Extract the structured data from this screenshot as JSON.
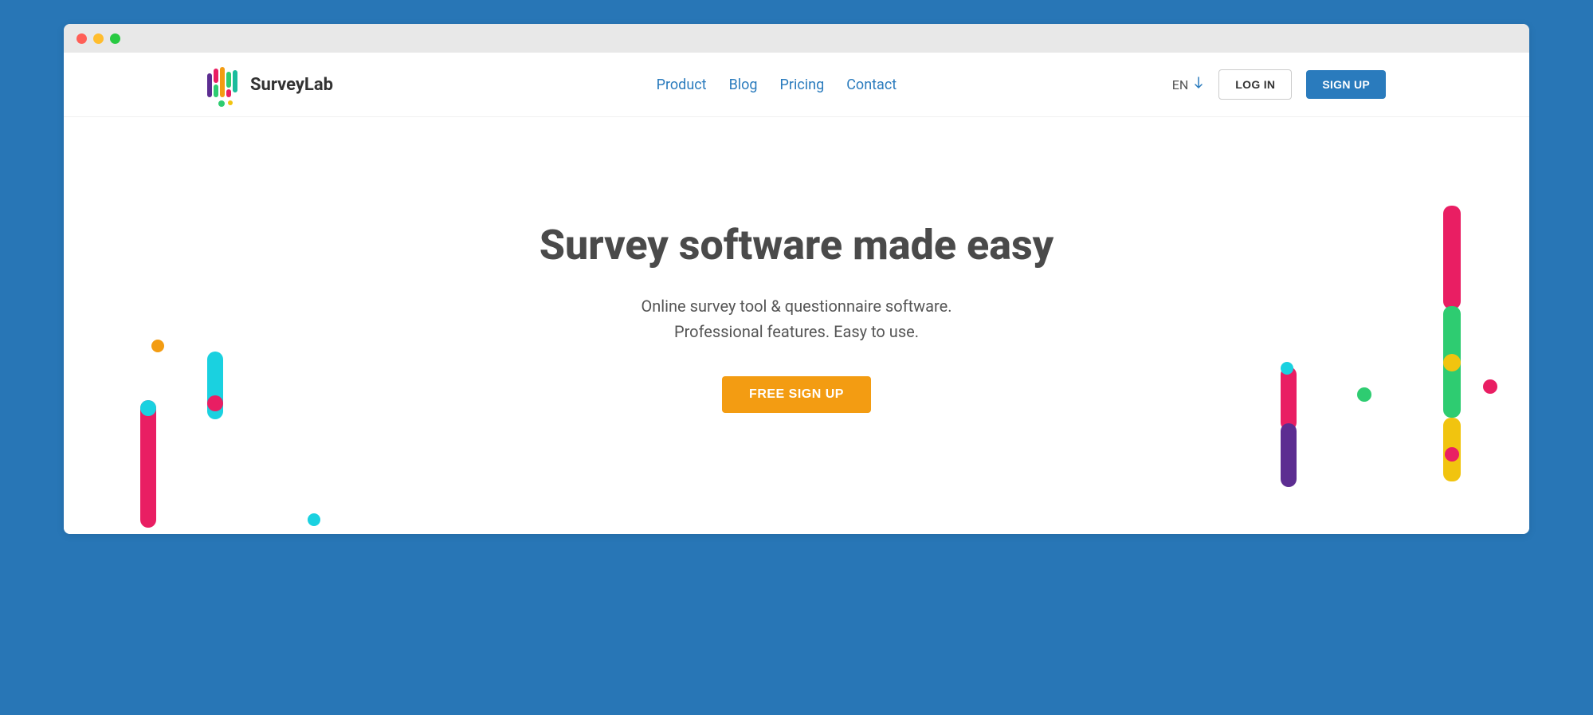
{
  "brand": {
    "name": "SurveyLab"
  },
  "nav": {
    "links": [
      {
        "label": "Product"
      },
      {
        "label": "Blog"
      },
      {
        "label": "Pricing"
      },
      {
        "label": "Contact"
      }
    ],
    "language": "EN",
    "login_label": "LOG IN",
    "signup_label": "SIGN UP"
  },
  "hero": {
    "title": "Survey software made easy",
    "subtitle_line1": "Online survey tool & questionnaire software.",
    "subtitle_line2": "Professional features. Easy to use.",
    "cta_label": "FREE SIGN UP"
  },
  "colors": {
    "accent_blue": "#2a7bbd",
    "accent_orange": "#f39c12",
    "page_bg": "#2876b6"
  }
}
